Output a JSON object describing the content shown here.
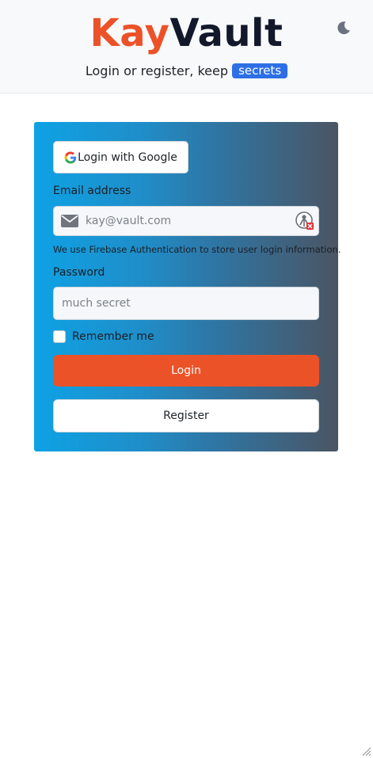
{
  "header": {
    "brand_part1": "Kay",
    "brand_part2": "Vault",
    "tagline_prefix": "Login or register, keep",
    "tagline_badge": "secrets",
    "theme_toggle_icon": "moon-icon",
    "colors": {
      "brand_orange": "#ec5228",
      "brand_dark": "#13192b",
      "badge_blue": "#2d6fe6"
    }
  },
  "form": {
    "google_button_label": "Login with Google",
    "google_icon": "google-g-icon",
    "email_label": "Email address",
    "email_icon": "envelope-icon",
    "email_placeholder": "kay@vault.com",
    "email_extension_icon": "password-manager-extension-icon",
    "email_help": "We use Firebase Authentication to store user login information.",
    "password_label": "Password",
    "password_placeholder": "much secret",
    "remember_label": "Remember me",
    "remember_checked": false,
    "login_button_label": "Login",
    "register_button_label": "Register",
    "colors": {
      "login_button": "#ec5228",
      "card_gradient_start": "#0ea2e5",
      "card_gradient_end": "#4b5563"
    }
  }
}
